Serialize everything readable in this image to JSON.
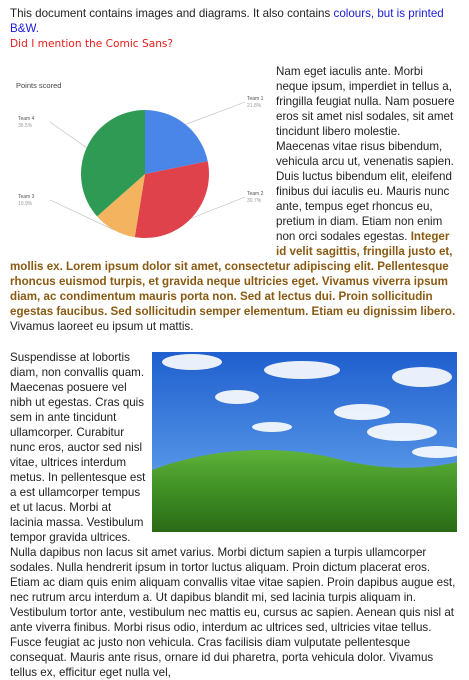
{
  "intro": {
    "line1_plain": "This document contains images and diagrams. It also contains ",
    "line1_blue": "colours, but is printed B&W.",
    "line2_red": "Did I mention the Comic Sans?"
  },
  "para1": {
    "text_before": "Nam eget iaculis ante. Morbi neque ipsum, imperdiet in tellus a, fringilla feugiat nulla. Nam posuere eros sit amet nisl sodales, sit amet tincidunt libero molestie. Maecenas vitae risus bibendum, vehicula arcu ut, venenatis sapien. Duis luctus bibendum elit, eleifend finibus dui iaculis eu. Mauris nunc ante, tempus eget rhoncus eu, pretium in diam. Etiam non enim non orci sodales egestas. ",
    "bold_gold": "Integer id velit sagittis, fringilla justo et, mollis ex. Lorem ipsum dolor sit amet, consectetur adipiscing elit. Pellentesque rhoncus euismod turpis, et gravida neque ultricies eget. Vivamus viverra ipsum diam, ac condimentum mauris porta non. Sed at lectus dui. Proin sollicitudin egestas faucibus. Sed sollicitudin semper elementum. Etiam eu dignissim libero.",
    "text_after": " Vivamus laoreet eu ipsum ut mattis."
  },
  "para2": {
    "text_before": "Suspendisse at lobortis diam, non convallis quam. Maecenas posuere vel nibh ut egestas. Cras quis sem in ante tincidunt ullamcorper. Curabitur nunc eros, auctor sed nisl vitae, ultrices interdum metus. In pellentesque est a est ullamcorper tempus et ut lacus. Morbi at lacinia massa. Vestibulum tempor gravida ultrices. Nulla dapibus non lacus sit amet varius. Morbi dictum sapien a turpis ullamcorper sodales. Nulla hendrerit ipsum in tortor luctus aliquam. Proin dictum placerat eros. Etiam ac diam quis enim aliquam convallis vitae vitae sapien. Proin dapibus augue est, nec rutrum arcu interdum a. Ut dapibus blandit mi, sed lacinia turpis aliquam in. Vestibulum tortor ante, vestibulum nec mattis eu, cursus ac sapien. Aenean quis nisl at ante viverra finibus. Morbi risus odio, interdum ac ultrices sed, ultricies vitae tellus. Fusce feugiat ac justo non vehicula. Cras facilisis diam vulputate pellentesque consequat. Mauris ante risus, ornare id dui pharetra, porta vehicula dolor. Vivamus tellus ex, efficitur eget nulla vel,"
  },
  "chart_data": {
    "type": "pie",
    "title": "Points scored",
    "series": [
      {
        "name": "Team 1",
        "value": 21.8,
        "label": "21.8%",
        "color": "#4a86e8"
      },
      {
        "name": "Team 2",
        "value": 30.7,
        "label": "30.7%",
        "color": "#e0424c"
      },
      {
        "name": "Team 3",
        "value": 10.9,
        "label": "10.9%",
        "color": "#f4b45f"
      },
      {
        "name": "Team 4",
        "value": 36.5,
        "label": "36.5%",
        "color": "#2e9a54"
      }
    ]
  },
  "photo": {
    "name": "landscape-photo",
    "sky_color": "#2f6fd1",
    "hill_color": "#4a9a2a"
  }
}
